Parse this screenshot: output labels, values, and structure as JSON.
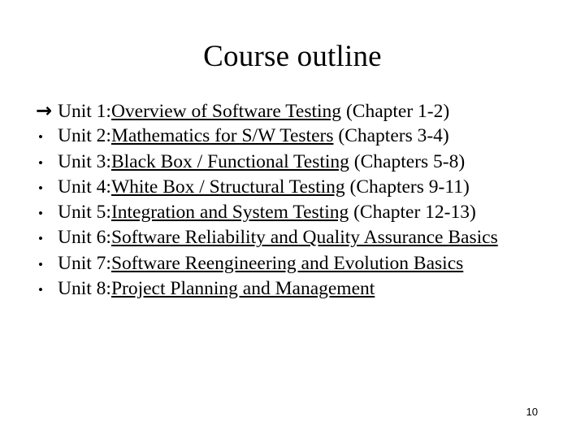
{
  "slide": {
    "title": "Course outline",
    "page_number": "10",
    "text_color": "#000000",
    "background_color": "#ffffff",
    "items": [
      {
        "marker": "arrow-marker",
        "marker_glyph": "→",
        "label": "Unit 1: ",
        "title": "Overview of Software Testing",
        "chapter": " (Chapter 1-2)"
      },
      {
        "marker": "bullet-marker",
        "marker_glyph": "•",
        "label": "Unit 2: ",
        "title": "Mathematics for S/W Testers",
        "chapter": " (Chapters 3-4)"
      },
      {
        "marker": "bullet-marker",
        "marker_glyph": "•",
        "label": "Unit 3: ",
        "title": "Black Box / Functional Testing",
        "chapter": " (Chapters 5-8)"
      },
      {
        "marker": "bullet-marker",
        "marker_glyph": "•",
        "label": "Unit 4: ",
        "title": "White Box / Structural Testing",
        "chapter": " (Chapters 9-11)"
      },
      {
        "marker": "bullet-marker",
        "marker_glyph": "•",
        "label": "Unit 5: ",
        "title": "Integration and System Testing",
        "chapter": " (Chapter 12-13)"
      },
      {
        "marker": "bullet-marker",
        "marker_glyph": "•",
        "label": "Unit 6: ",
        "title": "Software Reliability and Quality Assurance Basics",
        "chapter": ""
      },
      {
        "marker": "bullet-marker",
        "marker_glyph": "•",
        "label": "Unit 7: ",
        "title": "Software Reengineering and Evolution Basics",
        "chapter": ""
      },
      {
        "marker": "bullet-marker",
        "marker_glyph": "•",
        "label": "Unit 8: ",
        "title": "Project Planning and Management",
        "chapter": ""
      }
    ]
  }
}
